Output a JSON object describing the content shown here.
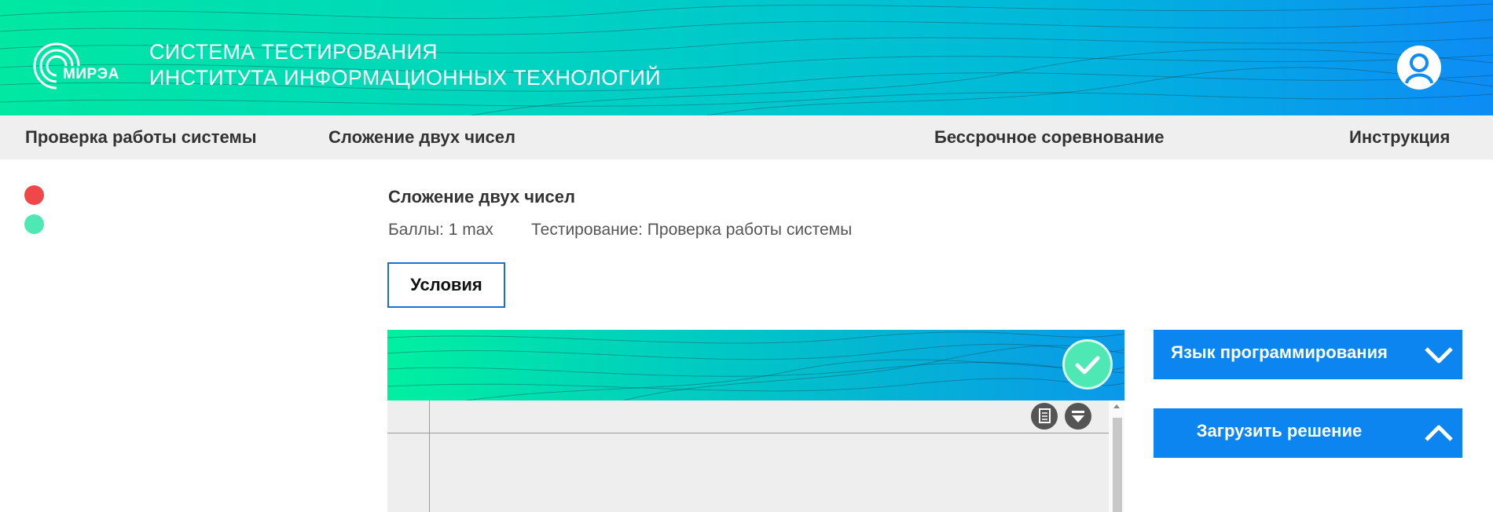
{
  "header": {
    "logo_text": "МИРЭА",
    "title_line1": "СИСТЕМА ТЕСТИРОВАНИЯ",
    "title_line2": "ИНСТИТУТА ИНФОРМАЦИОННЫХ ТЕХНОЛОГИЙ",
    "colors": {
      "gradient_start": "#00e8a2",
      "gradient_end": "#0d8cf5"
    }
  },
  "nav": {
    "items": [
      {
        "label": "Проверка работы системы"
      },
      {
        "label": "Сложение двух чисел"
      },
      {
        "label": "Бессрочное соревнование"
      },
      {
        "label": "Инструкция"
      }
    ]
  },
  "indicators": [
    {
      "name": "status-dot-red",
      "color": "#f04848"
    },
    {
      "name": "status-dot-green",
      "color": "#4de8b4"
    }
  ],
  "task": {
    "title": "Сложение двух чисел",
    "score": "Баллы: 1 max",
    "testing": "Тестирование: Проверка работы системы",
    "conditions_label": "Условия"
  },
  "editor": {
    "icons": [
      "check-icon",
      "document-icon",
      "dropdown-icon"
    ]
  },
  "right_panel": {
    "language_label": "Язык программирования",
    "upload_label": "Загрузить решение",
    "accent": "#0d85f0"
  }
}
